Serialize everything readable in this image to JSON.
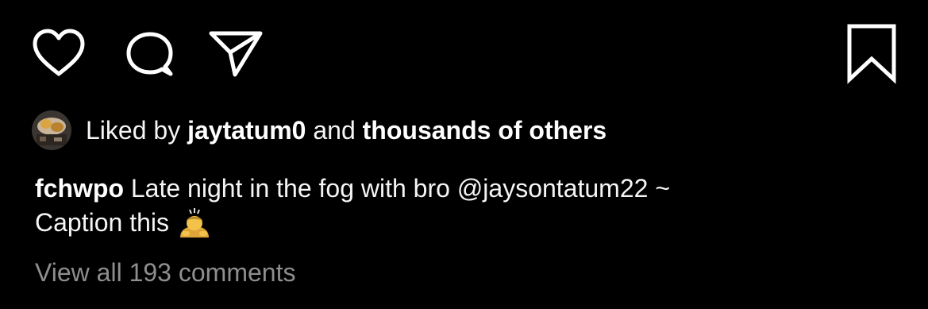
{
  "post": {
    "actions": {
      "like": "heart-icon",
      "comment": "comment-bubble-icon",
      "share": "paper-plane-icon",
      "save": "bookmark-icon"
    },
    "likes": {
      "prefix": "Liked by",
      "user": "jaytatum0",
      "connector": "and",
      "others": "thousands of others"
    },
    "caption": {
      "username": "fchwpo",
      "text_before_mention": "Late night in the fog with bro",
      "mention": "@jaysontatum22",
      "text_after_mention": "~",
      "line2": "Caption this",
      "emoji": "person-bowing-emoji"
    },
    "view_comments": "View all 193 comments"
  },
  "colors": {
    "background": "#000000",
    "text": "#ffffff",
    "muted": "#8e8e8e"
  }
}
